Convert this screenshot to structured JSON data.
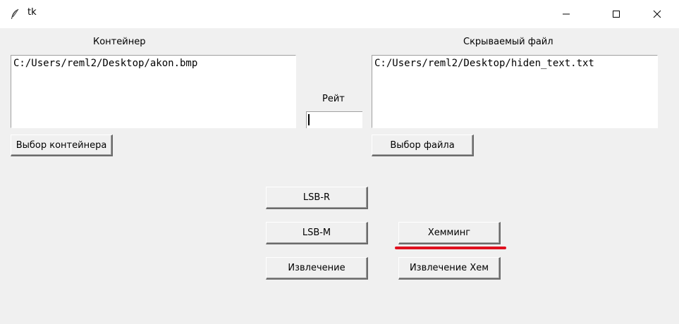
{
  "window": {
    "title": "tk",
    "minimize_icon": "minimize-icon",
    "maximize_icon": "maximize-icon",
    "close_icon": "close-icon"
  },
  "container": {
    "label": "Контейнер",
    "path_value": "C:/Users/reml2/Desktop/akon.bmp",
    "select_button": "Выбор контейнера"
  },
  "hidden_file": {
    "label": "Скрываемый файл",
    "path_value": "C:/Users/reml2/Desktop/hiden_text.txt",
    "select_button": "Выбор файла"
  },
  "rate": {
    "label": "Рейт",
    "value": ""
  },
  "buttons": {
    "lsb_r": "LSB-R",
    "lsb_m": "LSB-M",
    "hamming": "Хемминг",
    "extract": "Извлечение",
    "extract_hamming": "Извлечение Хем"
  },
  "colors": {
    "annotation": "#e0101e",
    "window_bg": "#f0f0f0",
    "titlebar_bg": "#ffffff"
  }
}
